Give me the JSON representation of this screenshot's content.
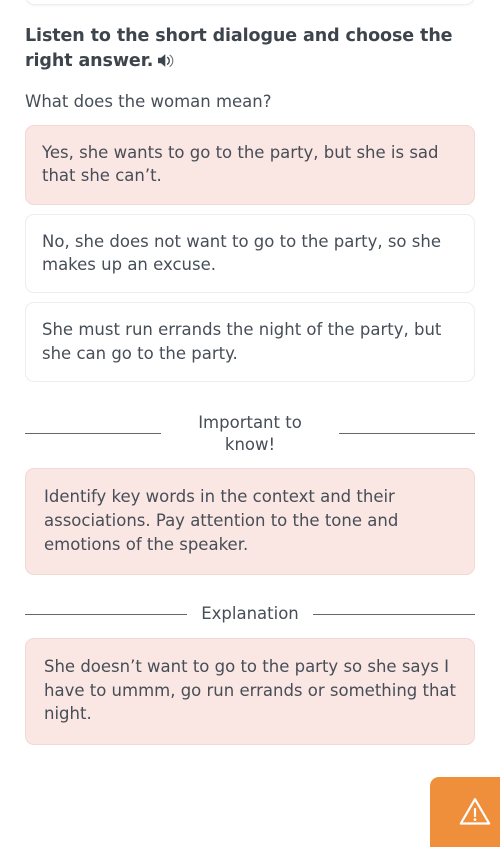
{
  "exercise": {
    "prompt_title": "Listen to the short dialogue and choose the right answer.",
    "audio_icon": "speaker-icon",
    "question": "What does the woman mean?",
    "options": [
      {
        "text": "Yes, she wants to go to the party, but she is sad that she can’t.",
        "state": "selected"
      },
      {
        "text": "No, she does not want to go to the party, so she makes up an excuse.",
        "state": "normal"
      },
      {
        "text": "She must run errands the night of the party, but she can go to the party.",
        "state": "normal"
      }
    ]
  },
  "tip_section": {
    "divider_label": "Important to know!",
    "body": "Identify key words in the context and their associations. Pay attention to the tone and emotions of the speaker."
  },
  "explanation_section": {
    "divider_label": "Explanation",
    "body": "She doesn’t want to go to the party so she says I have to ummm, go run errands or something that night."
  },
  "report_button": {
    "icon": "warning-triangle-icon",
    "label": ""
  },
  "colors": {
    "accent_pink_bg": "#fae6e3",
    "accent_pink_border": "#f3d8d5",
    "text": "#474e57",
    "heading": "#3d444c",
    "orange": "#ef8f3c",
    "box_border": "#ebedee",
    "divider_line": "#63686e"
  }
}
